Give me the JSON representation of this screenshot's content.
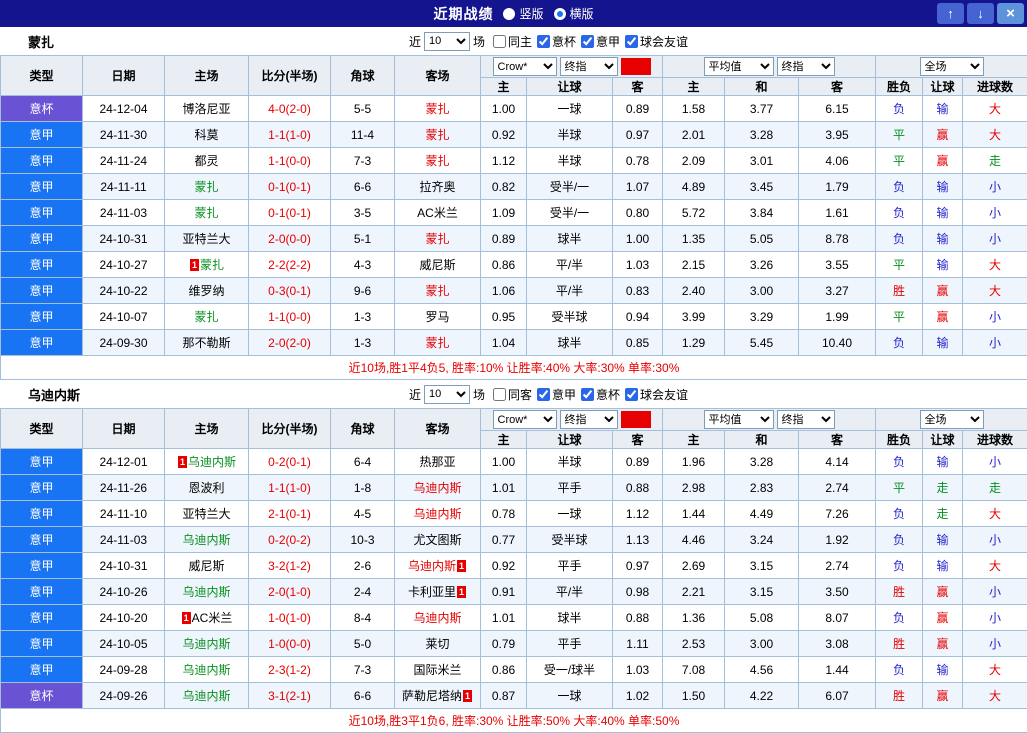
{
  "titlebar": {
    "title": "近期战绩",
    "layouts": [
      {
        "label": "竖版",
        "selected": false
      },
      {
        "label": "横版",
        "selected": true
      }
    ],
    "up": "↑",
    "down": "↓",
    "close": "×"
  },
  "filter_labels": {
    "near": "近",
    "matches": "场"
  },
  "dropdowns": {
    "ah_company": "Crow*",
    "ah_time": "终指",
    "eu_company": "平均值",
    "eu_time": "终指",
    "scope": "全场"
  },
  "columns": [
    "类型",
    "日期",
    "主场",
    "比分(半场)",
    "角球",
    "客场",
    "主",
    "让球",
    "客",
    "主",
    "和",
    "客",
    "胜负",
    "让球",
    "进球数"
  ],
  "colors": {
    "navy": "#14148F",
    "league_blue": "#1874F2",
    "cup_purple": "#6A52D4",
    "red": "#E60000",
    "green": "#089020",
    "blue": "#2424CC",
    "header_bg": "#E9EEF5",
    "row_alt": "#EEF5FC",
    "grid": "#A4BFDA"
  },
  "sections": [
    {
      "team": "蒙扎",
      "count": "10",
      "checkboxes": [
        {
          "label": "同主",
          "checked": false
        },
        {
          "label": "意杯",
          "checked": true
        },
        {
          "label": "意甲",
          "checked": true
        },
        {
          "label": "球会友谊",
          "checked": true
        }
      ],
      "rows": [
        {
          "type": "意杯",
          "tcls": "cup",
          "date": "24-12-04",
          "home": {
            "n": "博洛尼亚",
            "c": "black"
          },
          "score": "4-0(2-0)",
          "corner": "5-5",
          "away": {
            "n": "蒙扎",
            "c": "red"
          },
          "ah": [
            "1.00",
            "一球",
            "0.89"
          ],
          "eu": [
            "1.58",
            "3.77",
            "6.15"
          ],
          "res": {
            "t": "负",
            "c": "blue"
          },
          "hcp": {
            "t": "输",
            "c": "blue"
          },
          "goal": {
            "t": "大",
            "c": "red"
          }
        },
        {
          "type": "意甲",
          "tcls": "league",
          "date": "24-11-30",
          "home": {
            "n": "科莫",
            "c": "black"
          },
          "score": "1-1(1-0)",
          "corner": "11-4",
          "away": {
            "n": "蒙扎",
            "c": "red"
          },
          "ah": [
            "0.92",
            "半球",
            "0.97"
          ],
          "eu": [
            "2.01",
            "3.28",
            "3.95"
          ],
          "res": {
            "t": "平",
            "c": "green"
          },
          "hcp": {
            "t": "赢",
            "c": "red"
          },
          "goal": {
            "t": "大",
            "c": "red"
          }
        },
        {
          "type": "意甲",
          "tcls": "league",
          "date": "24-11-24",
          "home": {
            "n": "都灵",
            "c": "black"
          },
          "score": "1-1(0-0)",
          "corner": "7-3",
          "away": {
            "n": "蒙扎",
            "c": "red"
          },
          "ah": [
            "1.12",
            "半球",
            "0.78"
          ],
          "eu": [
            "2.09",
            "3.01",
            "4.06"
          ],
          "res": {
            "t": "平",
            "c": "green"
          },
          "hcp": {
            "t": "赢",
            "c": "red"
          },
          "goal": {
            "t": "走",
            "c": "green"
          }
        },
        {
          "type": "意甲",
          "tcls": "league",
          "date": "24-11-11",
          "home": {
            "n": "蒙扎",
            "c": "green"
          },
          "score": "0-1(0-1)",
          "corner": "6-6",
          "away": {
            "n": "拉齐奥",
            "c": "black"
          },
          "ah": [
            "0.82",
            "受半/一",
            "1.07"
          ],
          "eu": [
            "4.89",
            "3.45",
            "1.79"
          ],
          "res": {
            "t": "负",
            "c": "blue"
          },
          "hcp": {
            "t": "输",
            "c": "blue"
          },
          "goal": {
            "t": "小",
            "c": "blue"
          }
        },
        {
          "type": "意甲",
          "tcls": "league",
          "date": "24-11-03",
          "home": {
            "n": "蒙扎",
            "c": "green"
          },
          "score": "0-1(0-1)",
          "corner": "3-5",
          "away": {
            "n": "AC米兰",
            "c": "black"
          },
          "ah": [
            "1.09",
            "受半/一",
            "0.80"
          ],
          "eu": [
            "5.72",
            "3.84",
            "1.61"
          ],
          "res": {
            "t": "负",
            "c": "blue"
          },
          "hcp": {
            "t": "输",
            "c": "blue"
          },
          "goal": {
            "t": "小",
            "c": "blue"
          }
        },
        {
          "type": "意甲",
          "tcls": "league",
          "date": "24-10-31",
          "home": {
            "n": "亚特兰大",
            "c": "black"
          },
          "score": "2-0(0-0)",
          "corner": "5-1",
          "away": {
            "n": "蒙扎",
            "c": "red"
          },
          "ah": [
            "0.89",
            "球半",
            "1.00"
          ],
          "eu": [
            "1.35",
            "5.05",
            "8.78"
          ],
          "res": {
            "t": "负",
            "c": "blue"
          },
          "hcp": {
            "t": "输",
            "c": "blue"
          },
          "goal": {
            "t": "小",
            "c": "blue"
          }
        },
        {
          "type": "意甲",
          "tcls": "league",
          "date": "24-10-27",
          "home": {
            "n": "蒙扎",
            "c": "green",
            "card_pre": "1"
          },
          "score": "2-2(2-2)",
          "corner": "4-3",
          "away": {
            "n": "威尼斯",
            "c": "black"
          },
          "ah": [
            "0.86",
            "平/半",
            "1.03"
          ],
          "eu": [
            "2.15",
            "3.26",
            "3.55"
          ],
          "res": {
            "t": "平",
            "c": "green"
          },
          "hcp": {
            "t": "输",
            "c": "blue"
          },
          "goal": {
            "t": "大",
            "c": "red"
          }
        },
        {
          "type": "意甲",
          "tcls": "league",
          "date": "24-10-22",
          "home": {
            "n": "维罗纳",
            "c": "black"
          },
          "score": "0-3(0-1)",
          "corner": "9-6",
          "away": {
            "n": "蒙扎",
            "c": "red"
          },
          "ah": [
            "1.06",
            "平/半",
            "0.83"
          ],
          "eu": [
            "2.40",
            "3.00",
            "3.27"
          ],
          "res": {
            "t": "胜",
            "c": "red"
          },
          "hcp": {
            "t": "赢",
            "c": "red"
          },
          "goal": {
            "t": "大",
            "c": "red"
          }
        },
        {
          "type": "意甲",
          "tcls": "league",
          "date": "24-10-07",
          "home": {
            "n": "蒙扎",
            "c": "green"
          },
          "score": "1-1(0-0)",
          "corner": "1-3",
          "away": {
            "n": "罗马",
            "c": "black"
          },
          "ah": [
            "0.95",
            "受半球",
            "0.94"
          ],
          "eu": [
            "3.99",
            "3.29",
            "1.99"
          ],
          "res": {
            "t": "平",
            "c": "green"
          },
          "hcp": {
            "t": "赢",
            "c": "red"
          },
          "goal": {
            "t": "小",
            "c": "blue"
          }
        },
        {
          "type": "意甲",
          "tcls": "league",
          "date": "24-09-30",
          "home": {
            "n": "那不勒斯",
            "c": "black"
          },
          "score": "2-0(2-0)",
          "corner": "1-3",
          "away": {
            "n": "蒙扎",
            "c": "red"
          },
          "ah": [
            "1.04",
            "球半",
            "0.85"
          ],
          "eu": [
            "1.29",
            "5.45",
            "10.40"
          ],
          "res": {
            "t": "负",
            "c": "blue"
          },
          "hcp": {
            "t": "输",
            "c": "blue"
          },
          "goal": {
            "t": "小",
            "c": "blue"
          }
        }
      ],
      "summary": "近10场,胜1平4负5, 胜率:10% 让胜率:40% 大率:30% 单率:30%"
    },
    {
      "team": "乌迪内斯",
      "count": "10",
      "checkboxes": [
        {
          "label": "同客",
          "checked": false
        },
        {
          "label": "意甲",
          "checked": true
        },
        {
          "label": "意杯",
          "checked": true
        },
        {
          "label": "球会友谊",
          "checked": true
        }
      ],
      "rows": [
        {
          "type": "意甲",
          "tcls": "league",
          "date": "24-12-01",
          "home": {
            "n": "乌迪内斯",
            "c": "green",
            "card_pre": "1"
          },
          "score": "0-2(0-1)",
          "corner": "6-4",
          "away": {
            "n": "热那亚",
            "c": "black"
          },
          "ah": [
            "1.00",
            "半球",
            "0.89"
          ],
          "eu": [
            "1.96",
            "3.28",
            "4.14"
          ],
          "res": {
            "t": "负",
            "c": "blue"
          },
          "hcp": {
            "t": "输",
            "c": "blue"
          },
          "goal": {
            "t": "小",
            "c": "blue"
          }
        },
        {
          "type": "意甲",
          "tcls": "league",
          "date": "24-11-26",
          "home": {
            "n": "恩波利",
            "c": "black"
          },
          "score": "1-1(1-0)",
          "corner": "1-8",
          "away": {
            "n": "乌迪内斯",
            "c": "red"
          },
          "ah": [
            "1.01",
            "平手",
            "0.88"
          ],
          "eu": [
            "2.98",
            "2.83",
            "2.74"
          ],
          "res": {
            "t": "平",
            "c": "green"
          },
          "hcp": {
            "t": "走",
            "c": "green"
          },
          "goal": {
            "t": "走",
            "c": "green"
          }
        },
        {
          "type": "意甲",
          "tcls": "league",
          "date": "24-11-10",
          "home": {
            "n": "亚特兰大",
            "c": "black"
          },
          "score": "2-1(0-1)",
          "corner": "4-5",
          "away": {
            "n": "乌迪内斯",
            "c": "red"
          },
          "ah": [
            "0.78",
            "一球",
            "1.12"
          ],
          "eu": [
            "1.44",
            "4.49",
            "7.26"
          ],
          "res": {
            "t": "负",
            "c": "blue"
          },
          "hcp": {
            "t": "走",
            "c": "green"
          },
          "goal": {
            "t": "大",
            "c": "red"
          }
        },
        {
          "type": "意甲",
          "tcls": "league",
          "date": "24-11-03",
          "home": {
            "n": "乌迪内斯",
            "c": "green"
          },
          "score": "0-2(0-2)",
          "corner": "10-3",
          "away": {
            "n": "尤文图斯",
            "c": "black"
          },
          "ah": [
            "0.77",
            "受半球",
            "1.13"
          ],
          "eu": [
            "4.46",
            "3.24",
            "1.92"
          ],
          "res": {
            "t": "负",
            "c": "blue"
          },
          "hcp": {
            "t": "输",
            "c": "blue"
          },
          "goal": {
            "t": "小",
            "c": "blue"
          }
        },
        {
          "type": "意甲",
          "tcls": "league",
          "date": "24-10-31",
          "home": {
            "n": "威尼斯",
            "c": "black"
          },
          "score": "3-2(1-2)",
          "corner": "2-6",
          "away": {
            "n": "乌迪内斯",
            "c": "red",
            "card_post": "1"
          },
          "ah": [
            "0.92",
            "平手",
            "0.97"
          ],
          "eu": [
            "2.69",
            "3.15",
            "2.74"
          ],
          "res": {
            "t": "负",
            "c": "blue"
          },
          "hcp": {
            "t": "输",
            "c": "blue"
          },
          "goal": {
            "t": "大",
            "c": "red"
          }
        },
        {
          "type": "意甲",
          "tcls": "league",
          "date": "24-10-26",
          "home": {
            "n": "乌迪内斯",
            "c": "green"
          },
          "score": "2-0(1-0)",
          "corner": "2-4",
          "away": {
            "n": "卡利亚里",
            "c": "black",
            "card_post": "1"
          },
          "ah": [
            "0.91",
            "平/半",
            "0.98"
          ],
          "eu": [
            "2.21",
            "3.15",
            "3.50"
          ],
          "res": {
            "t": "胜",
            "c": "red"
          },
          "hcp": {
            "t": "赢",
            "c": "red"
          },
          "goal": {
            "t": "小",
            "c": "blue"
          }
        },
        {
          "type": "意甲",
          "tcls": "league",
          "date": "24-10-20",
          "home": {
            "n": "AC米兰",
            "c": "black",
            "card_pre": "1"
          },
          "score": "1-0(1-0)",
          "corner": "8-4",
          "away": {
            "n": "乌迪内斯",
            "c": "red"
          },
          "ah": [
            "1.01",
            "球半",
            "0.88"
          ],
          "eu": [
            "1.36",
            "5.08",
            "8.07"
          ],
          "res": {
            "t": "负",
            "c": "blue"
          },
          "hcp": {
            "t": "赢",
            "c": "red"
          },
          "goal": {
            "t": "小",
            "c": "blue"
          }
        },
        {
          "type": "意甲",
          "tcls": "league",
          "date": "24-10-05",
          "home": {
            "n": "乌迪内斯",
            "c": "green"
          },
          "score": "1-0(0-0)",
          "corner": "5-0",
          "away": {
            "n": "莱切",
            "c": "black"
          },
          "ah": [
            "0.79",
            "平手",
            "1.11"
          ],
          "eu": [
            "2.53",
            "3.00",
            "3.08"
          ],
          "res": {
            "t": "胜",
            "c": "red"
          },
          "hcp": {
            "t": "赢",
            "c": "red"
          },
          "goal": {
            "t": "小",
            "c": "blue"
          }
        },
        {
          "type": "意甲",
          "tcls": "league",
          "date": "24-09-28",
          "home": {
            "n": "乌迪内斯",
            "c": "green"
          },
          "score": "2-3(1-2)",
          "corner": "7-3",
          "away": {
            "n": "国际米兰",
            "c": "black"
          },
          "ah": [
            "0.86",
            "受一/球半",
            "1.03"
          ],
          "eu": [
            "7.08",
            "4.56",
            "1.44"
          ],
          "res": {
            "t": "负",
            "c": "blue"
          },
          "hcp": {
            "t": "输",
            "c": "blue"
          },
          "goal": {
            "t": "大",
            "c": "red"
          }
        },
        {
          "type": "意杯",
          "tcls": "cup",
          "date": "24-09-26",
          "home": {
            "n": "乌迪内斯",
            "c": "green"
          },
          "score": "3-1(2-1)",
          "corner": "6-6",
          "away": {
            "n": "萨勒尼塔纳",
            "c": "black",
            "card_post": "1"
          },
          "ah": [
            "0.87",
            "一球",
            "1.02"
          ],
          "eu": [
            "1.50",
            "4.22",
            "6.07"
          ],
          "res": {
            "t": "胜",
            "c": "red"
          },
          "hcp": {
            "t": "赢",
            "c": "red"
          },
          "goal": {
            "t": "大",
            "c": "red"
          }
        }
      ],
      "summary": "近10场,胜3平1负6, 胜率:30% 让胜率:50% 大率:40% 单率:50%"
    }
  ]
}
